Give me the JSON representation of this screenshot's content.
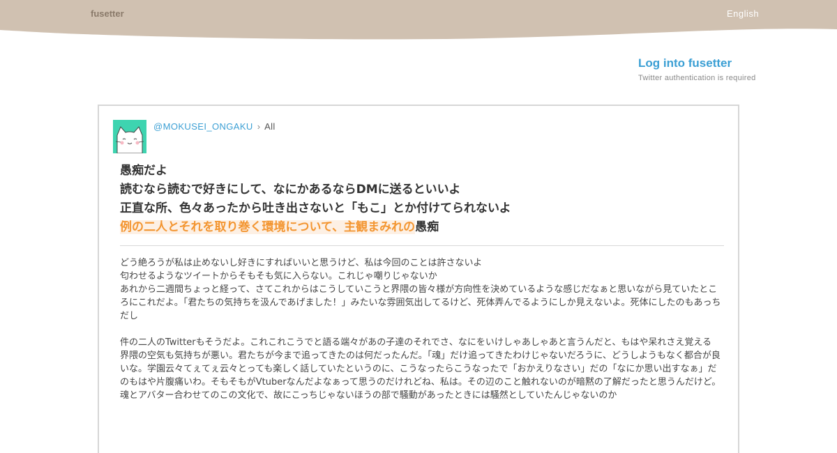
{
  "header": {
    "brand": "fusetter",
    "language": "English",
    "colors": {
      "header_bg": "#d0c1b1",
      "band_bg": "#f1f1f1",
      "link": "#3b9fd4",
      "highlight": "#f39530"
    }
  },
  "login": {
    "label": "Log into fusetter",
    "note": "Twitter authentication is required"
  },
  "post": {
    "author_handle": "@MOKUSEI_ONGAKU",
    "breadcrumb_separator": "›",
    "scope": "All",
    "avatar_icon": "cat-avatar-icon",
    "title_lines": [
      "愚痴だよ",
      "読むなら読むで好きにして、なにかあるならDMに送るといいよ",
      "正直な所、色々あったから吐き出さないと「もこ」とか付けてられないよ"
    ],
    "title_last_highlight": "例の二人とそれを取り巻く環境について、主観まみれの",
    "title_last_rest": "愚痴",
    "body_paragraphs": [
      "どう絶ろうが私は止めないし好きにすればいいと思うけど、私は今回のことは許さないよ",
      "匂わせるようなツイートからそもそも気に入らない。これじゃ嘲りじゃないか",
      "あれから二週間ちょっと経って、さてこれからはこうしていこうと界隈の皆々様が方向性を決めているような感じだなぁと思いながら見ていたところにこれだよ。「君たちの気持ちを汲んであげました！」みたいな雰囲気出してるけど、死体弄んでるようにしか見えないよ。死体にしたのもあっちだし",
      "",
      "件の二人のTwitterもそうだよ。これこれこうでと語る端々があの子達のそれでさ、なにをいけしゃあしゃあと言うんだと、もはや呆れさえ覚える",
      "界隈の空気も気持ちが悪い。君たちが今まで追ってきたのは何だったんだ。「魂」だけ追ってきたわけじゃないだろうに、どうしようもなく都合が良いな。学園云々てぇてぇ云々とっても楽しく話していたというのに、こうなったらこうなったで「おかえりなさい」だの「なにか思い出すなぁ」だのもはや片腹痛いわ。そもそもがVtuberなんだよなぁって思うのだけれどね、私は。その辺のこと触れないのが暗黙の了解だったと思うんだけど。魂とアバター合わせてのこの文化で、故にこっちじゃないほうの部で騒動があったときには騒然としていたんじゃないのか"
    ]
  }
}
